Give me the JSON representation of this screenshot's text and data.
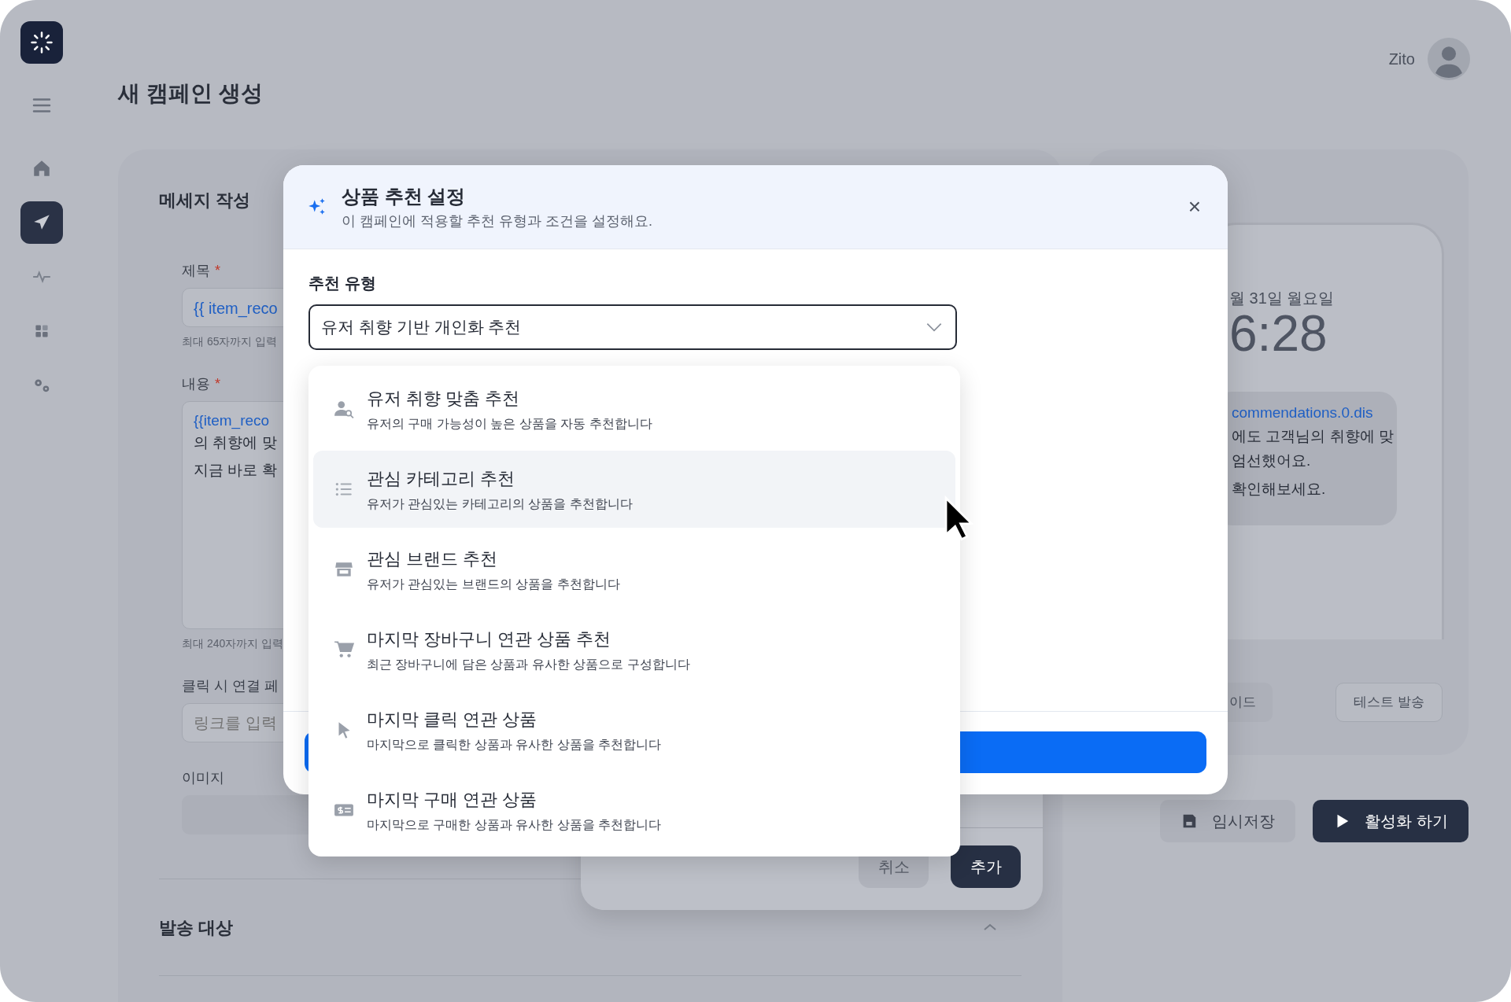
{
  "sidebar": {
    "items": [
      {
        "selected": false
      },
      {
        "selected": true
      },
      {
        "selected": false
      },
      {
        "selected": false
      },
      {
        "selected": false
      }
    ]
  },
  "page_title": "새 캠페인 생성",
  "user": {
    "name": "Zito"
  },
  "message_card": {
    "title": "메세지 작성",
    "subject": {
      "label": "제목",
      "required_mark": "*",
      "value": "{{ item_reco",
      "hint": "최대 65자까지 입력"
    },
    "content": {
      "label": "내용",
      "required_mark": "*",
      "lines": [
        {
          "text": "{{item_reco",
          "kind": "template"
        },
        {
          "text": "의 취향에 맞",
          "kind": "plain"
        },
        {
          "text": "지금 바로 확",
          "kind": "plain"
        }
      ],
      "hint": "최대 240자까지 입력"
    },
    "link": {
      "label": "클릭 시 연결 페",
      "placeholder": "링크를 입력"
    },
    "image": {
      "label": "이미지"
    },
    "section": {
      "title": "발송 대상",
      "expanded": true
    }
  },
  "preview": {
    "date": "월 31일 월요일",
    "time": "6:28",
    "notification": [
      {
        "text": "commendations.0.dis",
        "kind": "template"
      },
      {
        "text": "에도 고객님의 취향에 맞",
        "kind": "plain"
      },
      {
        "text": "엄선했어요.",
        "kind": "plain"
      },
      {
        "text": "확인해보세요.",
        "kind": "plain"
      }
    ],
    "buttons": [
      "이드",
      "테스트 발송"
    ]
  },
  "actions": [
    {
      "label": "임시저장",
      "kind": "secondary"
    },
    {
      "label": "활성화 하기",
      "kind": "primary"
    }
  ],
  "back_dialog": {
    "buttons": [
      {
        "label": "취소",
        "kind": "secondary"
      },
      {
        "label": "추가",
        "kind": "primary"
      }
    ]
  },
  "modal": {
    "close": "×",
    "title": "상품 추천 설정",
    "subtitle": "이 캠페인에 적용할 추천 유형과 조건을 설정해요.",
    "field_label": "추천 유형",
    "select_value": "유저 취향 기반 개인화 추천",
    "options": [
      {
        "title": "유저 취향 맞춤 추천",
        "description": "유저의 구매 가능성이 높은 상품을 자동 추천합니다",
        "highlighted": false
      },
      {
        "title": "관심 카테고리 추천",
        "description": "유저가 관심있는 카테고리의 상품을 추천합니다",
        "highlighted": true
      },
      {
        "title": "관심 브랜드 추천",
        "description": "유저가 관심있는 브랜드의 상품을 추천합니다",
        "highlighted": false
      },
      {
        "title": "마지막 장바구니 연관 상품 추천",
        "description": "최근 장바구니에 담은 상품과 유사한 상품으로 구성합니다",
        "highlighted": false
      },
      {
        "title": "마지막 클릭 연관 상품",
        "description": "마지막으로 클릭한 상품과 유사한 상품을 추천합니다",
        "highlighted": false
      },
      {
        "title": "마지막 구매 연관 상품",
        "description": "마지막으로 구매한 상품과 유사한 상품을 추천합니다",
        "highlighted": false
      }
    ]
  }
}
